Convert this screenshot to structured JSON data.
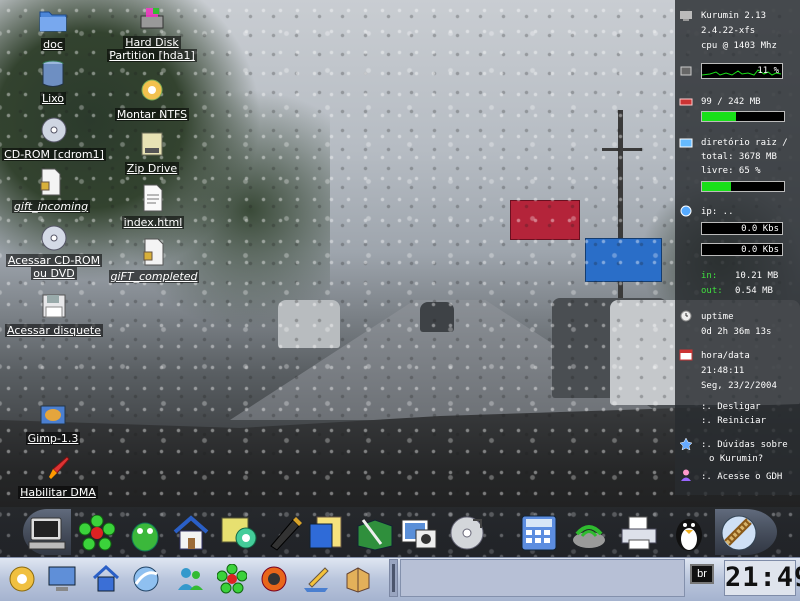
{
  "desktop_icons": {
    "doc": "doc",
    "lixo": "Lixo",
    "cdrom": "CD-ROM [cdrom1]",
    "gift_incoming": "gift_incoming",
    "acessar_cd_1": "Acessar CD-ROM",
    "acessar_cd_2": "ou DVD",
    "acessar_disquete": "Acessar disquete",
    "gimp": "Gimp-1.3",
    "habilitar_dma": "Habilitar DMA",
    "hard_disk_1": "Hard Disk",
    "hard_disk_2": "Partition [hda1]",
    "montar_ntfs": "Montar NTFS",
    "zip_drive": "Zip Drive",
    "index_html": "index.html",
    "gift_completed": "giFT_completed"
  },
  "sysmon": {
    "host": "Kurumin 2.13",
    "kernel": "2.4.22-xfs",
    "cpu": "cpu @ 1403 Mhz",
    "cpu_percent_label": "11 %",
    "cpu_percent": 11,
    "memory": "99 / 242 MB",
    "memory_fraction": 0.41,
    "disk_title": "diretório raiz /",
    "disk_total": "total: 3678 MB",
    "disk_free": "livre: 65 %",
    "disk_used_fraction": 0.35,
    "ip_label": "ip: ..",
    "net_in_rate": "0.0 Kbs",
    "net_out_rate": "0.0 Kbs",
    "in_label": "in:",
    "in_value": "10.21 MB",
    "out_label": "out:",
    "out_value": "0.54 MB",
    "uptime_label": "uptime",
    "uptime_value": "0d 2h 36m 13s",
    "datetime_label": "hora/data",
    "time_value": "21:48:11",
    "date_value": "Seg, 23/2/2004",
    "shutdown": ":. Desligar",
    "reboot": ":. Reiniciar",
    "help_1": ":. Dúvidas sobre",
    "help_2": "o Kurumin?",
    "gdh": ":. Acesse o GDH"
  },
  "panel": {
    "lang": "br",
    "clock": "21:49"
  },
  "colors": {
    "bar_fill": "#19e019",
    "panel_bg": "#282c30",
    "taskbar": "#b9c5dc"
  }
}
